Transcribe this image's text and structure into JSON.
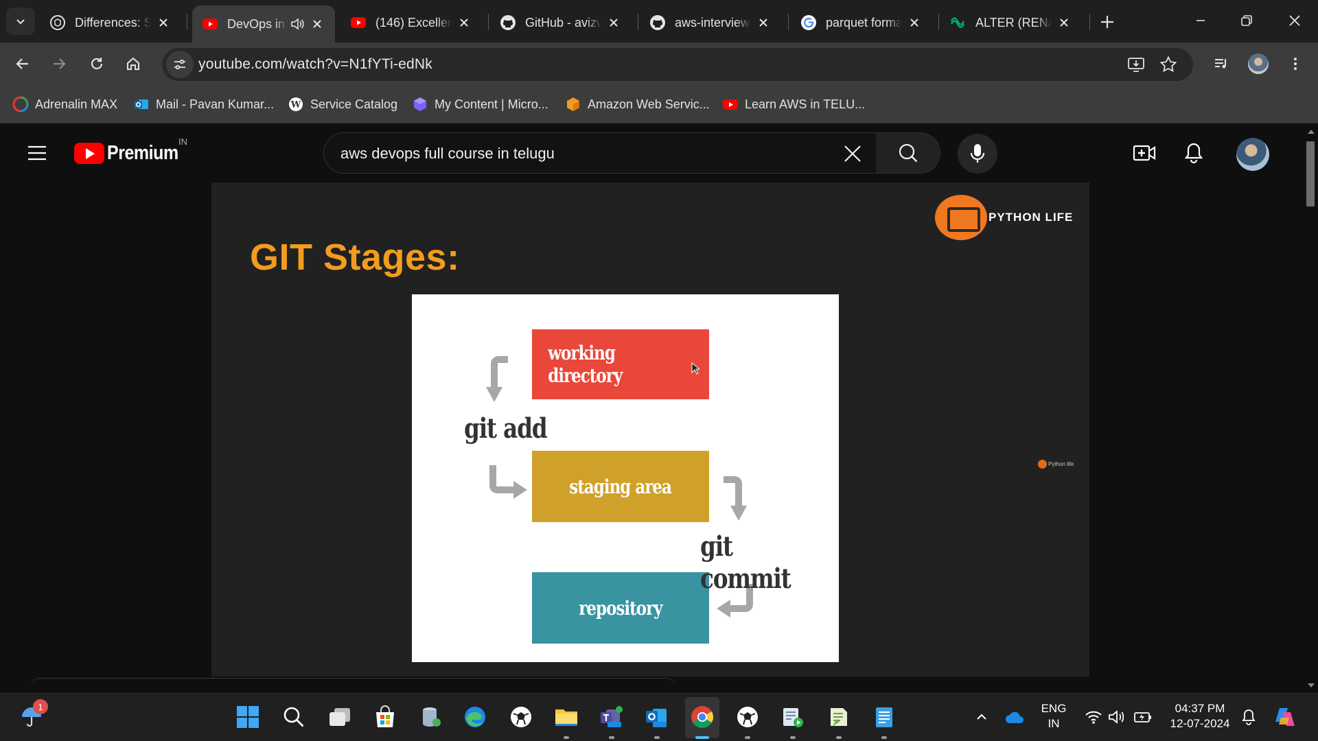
{
  "browser": {
    "tabs": [
      {
        "title": "Differences: S",
        "icon": "chatgpt-icon",
        "active": false
      },
      {
        "title": "DevOps in",
        "icon": "youtube-icon",
        "active": true,
        "audio": true
      },
      {
        "title": "(146) Excellent",
        "icon": "youtube-icon",
        "active": false
      },
      {
        "title": "GitHub - avizw",
        "icon": "github-icon",
        "active": false
      },
      {
        "title": "aws-interview",
        "icon": "github-icon",
        "active": false
      },
      {
        "title": "parquet forma",
        "icon": "google-icon",
        "active": false
      },
      {
        "title": "ALTER (RENAM",
        "icon": "w3-icon",
        "active": false
      }
    ],
    "url": "youtube.com/watch?v=N1fYTi-edNk",
    "bookmarks": [
      {
        "label": "Adrenalin MAX",
        "icon": "adrenalin-icon"
      },
      {
        "label": "Mail - Pavan Kumar...",
        "icon": "outlook-icon"
      },
      {
        "label": "Service Catalog",
        "icon": "wordpress-icon"
      },
      {
        "label": "My Content | Micro...",
        "icon": "microsoft-learn-icon"
      },
      {
        "label": "Amazon Web Servic...",
        "icon": "aws-icon"
      },
      {
        "label": "Learn AWS in TELU...",
        "icon": "youtube-icon"
      }
    ]
  },
  "youtube": {
    "brand": "Premium",
    "country": "IN",
    "search_query": "aws devops full course in telugu"
  },
  "video": {
    "slide_title": "GIT Stages:",
    "channel_logo_text": "PYTHON LIFE",
    "watermark": "Python life",
    "diagram": {
      "stages": [
        "working directory",
        "staging area",
        "repository"
      ],
      "labels": {
        "add": "git add",
        "commit": "git commit"
      }
    }
  },
  "taskbar": {
    "notification_count": "1",
    "language": "ENG",
    "region": "IN",
    "time": "04:37 PM",
    "date": "12-07-2024"
  },
  "colors": {
    "slide_title": "#f39c1f",
    "working_directory": "#e9473a",
    "staging_area": "#d0a12a",
    "repository": "#3a93a1",
    "youtube_red": "#ff0000"
  }
}
